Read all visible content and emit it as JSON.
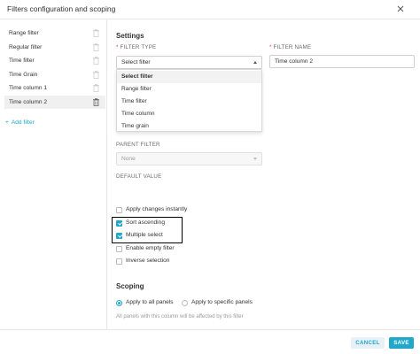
{
  "modal": {
    "title": "Filters configuration and scoping"
  },
  "sidebar": {
    "items": [
      {
        "label": "Range filter"
      },
      {
        "label": "Regular filter"
      },
      {
        "label": "Time filter"
      },
      {
        "label": "Time Grain"
      },
      {
        "label": "Time column 1"
      },
      {
        "label": "Time column 2"
      }
    ],
    "add_filter": "Add filter"
  },
  "settings": {
    "title": "Settings",
    "filter_type_label": "FILTER TYPE",
    "filter_type_placeholder": "Select filter",
    "filter_type_options": [
      "Select filter",
      "Range filter",
      "Time filter",
      "Time column",
      "Time grain"
    ],
    "filter_name_label": "FILTER NAME",
    "filter_name_value": "Time column 2",
    "parent_filter_label": "PARENT FILTER",
    "parent_filter_value": "None",
    "default_value_label": "DEFAULT VALUE"
  },
  "options": [
    {
      "label": "Apply changes instantly",
      "checked": false
    },
    {
      "label": "Sort ascending",
      "checked": true
    },
    {
      "label": "Multiple select",
      "checked": true
    },
    {
      "label": "Enable empty filter",
      "checked": false
    },
    {
      "label": "Inverse selection",
      "checked": false
    }
  ],
  "scoping": {
    "title": "Scoping",
    "apply_all": "Apply to all panels",
    "apply_specific": "Apply to specific panels",
    "hint": "All panels with this column will be affected by this filter"
  },
  "footer": {
    "cancel": "CANCEL",
    "save": "SAVE"
  },
  "colors": {
    "accent": "#20a7c9",
    "required": "#e04355"
  }
}
